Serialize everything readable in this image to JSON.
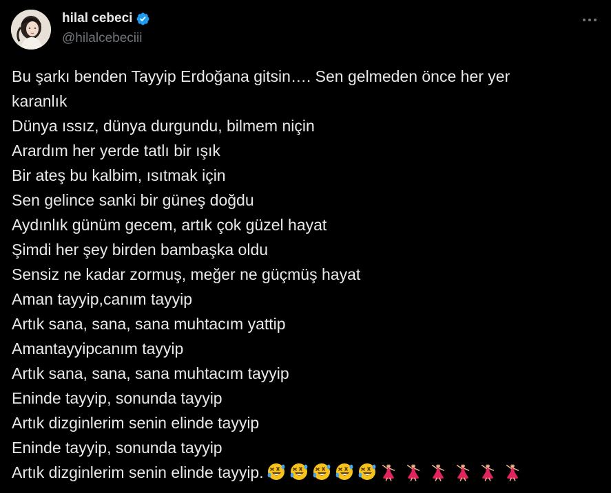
{
  "author": {
    "display_name": "hilal cebeci",
    "handle": "@hilalcebeciii",
    "verified": true,
    "verified_color": "#1d9bf0"
  },
  "menu": {
    "icon": "more-horizontal-icon"
  },
  "tweet": {
    "lines": [
      "Bu şarkı benden Tayyip Erdoğana gitsin…. Sen gelmeden önce her yer",
      "karanlık",
      "Dünya ıssız, dünya durgundu, bilmem niçin",
      "Arardım her yerde tatlı bir ışık",
      "Bir ateş bu kalbim, ısıtmak için",
      "Sen gelince sanki bir güneş doğdu",
      "Aydınlık günüm gecem, artık çok güzel hayat",
      "Şimdi her şey birden bambaşka oldu",
      "Sensiz ne kadar zormuş, meğer ne güçmüş hayat",
      "Aman tayyip,canım tayyip",
      "Artık sana, sana, sana muhtacım yattip",
      "Amantayyipcanım tayyip",
      "Artık sana, sana, sana muhtacım tayyip",
      "Eninde tayyip, sonunda tayyip",
      "Artık dizginlerim senin elinde tayyip",
      "Eninde tayyip, sonunda tayyip",
      "Artık dizginlerim senin elinde tayyip."
    ],
    "trailing_emojis": [
      "rolling-on-floor-laughing",
      "rolling-on-floor-laughing",
      "rolling-on-floor-laughing",
      "rolling-on-floor-laughing",
      "rolling-on-floor-laughing",
      "woman-dancing",
      "woman-dancing",
      "woman-dancing",
      "woman-dancing",
      "woman-dancing",
      "woman-dancing"
    ]
  },
  "colors": {
    "background": "#000000",
    "text": "#e7e9ea",
    "secondary_text": "#71767b"
  }
}
